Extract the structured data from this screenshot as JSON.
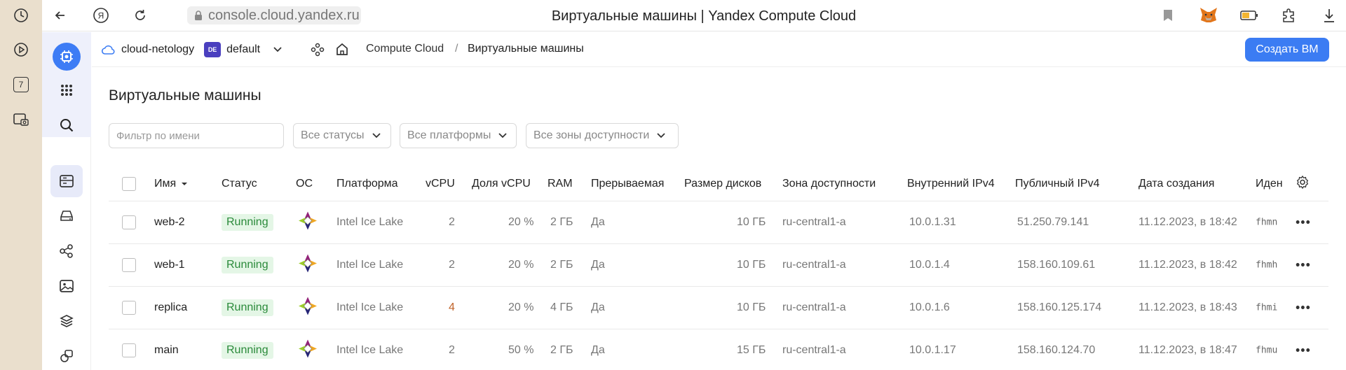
{
  "browser": {
    "url": "console.cloud.yandex.ru",
    "title": "Виртуальные машины | Yandex Compute Cloud",
    "side_number": "7"
  },
  "header": {
    "cloud_name": "cloud-netology",
    "folder_badge": "DE",
    "folder_name": "default",
    "breadcrumb_service": "Compute Cloud",
    "breadcrumb_separator": "/",
    "breadcrumb_page": "Виртуальные машины",
    "create_button": "Создать ВМ"
  },
  "page": {
    "title": "Виртуальные машины",
    "filter_placeholder": "Фильтр по имени",
    "status_filter": "Все статусы",
    "platform_filter": "Все платформы",
    "zone_filter": "Все зоны доступности"
  },
  "table": {
    "columns": [
      "Имя",
      "Статус",
      "ОС",
      "Платформа",
      "vCPU",
      "Доля vCPU",
      "RAM",
      "Прерываемая",
      "Размер дисков",
      "Зона доступности",
      "Внутренний IPv4",
      "Публичный IPv4",
      "Дата создания",
      "Иден"
    ],
    "rows": [
      {
        "name": "web-2",
        "status": "Running",
        "platform": "Intel Ice Lake",
        "vcpu": "2",
        "vcpu_share": "20 %",
        "ram": "2 ГБ",
        "preemptible": "Да",
        "disk": "10 ГБ",
        "zone": "ru-central1-a",
        "ipv4_internal": "10.0.1.31",
        "ipv4_public": "51.250.79.141",
        "created": "11.12.2023, в 18:42",
        "id": "fhmn"
      },
      {
        "name": "web-1",
        "status": "Running",
        "platform": "Intel Ice Lake",
        "vcpu": "2",
        "vcpu_share": "20 %",
        "ram": "2 ГБ",
        "preemptible": "Да",
        "disk": "10 ГБ",
        "zone": "ru-central1-a",
        "ipv4_internal": "10.0.1.4",
        "ipv4_public": "158.160.109.61",
        "created": "11.12.2023, в 18:42",
        "id": "fhmh"
      },
      {
        "name": "replica",
        "status": "Running",
        "platform": "Intel Ice Lake",
        "vcpu": "4",
        "vcpu_share": "20 %",
        "ram": "4 ГБ",
        "preemptible": "Да",
        "disk": "10 ГБ",
        "zone": "ru-central1-a",
        "ipv4_internal": "10.0.1.6",
        "ipv4_public": "158.160.125.174",
        "created": "11.12.2023, в 18:43",
        "id": "fhmi"
      },
      {
        "name": "main",
        "status": "Running",
        "platform": "Intel Ice Lake",
        "vcpu": "2",
        "vcpu_share": "50 %",
        "ram": "2 ГБ",
        "preemptible": "Да",
        "disk": "15 ГБ",
        "zone": "ru-central1-a",
        "ipv4_internal": "10.0.1.17",
        "ipv4_public": "158.160.124.70",
        "created": "11.12.2023, в 18:47",
        "id": "fhmu"
      }
    ]
  },
  "colors": {
    "accent": "#3b7cf3",
    "running_bg": "#e4f6e6",
    "running_text": "#2a8a3a",
    "browser_side": "#eadfcd"
  }
}
